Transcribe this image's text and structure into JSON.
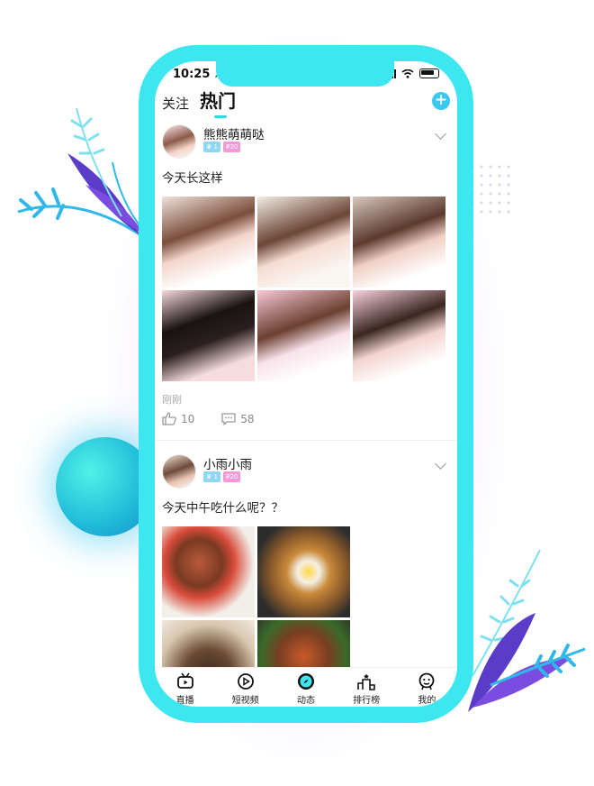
{
  "status_bar": {
    "time": "10:25",
    "time_arrow": "➚"
  },
  "tabs": {
    "follow": "关注",
    "hot": "热门"
  },
  "add_button": "+",
  "posts": [
    {
      "username": "熊熊萌萌哒",
      "level": "1",
      "points": "20",
      "caption": "今天长这样",
      "time_ago": "刚刚",
      "likes": "10",
      "comments": "58",
      "photo_count": 6
    },
    {
      "username": "小雨小雨",
      "level": "1",
      "points": "20",
      "caption": "今天中午吃什么呢？？",
      "photo_count": 4
    }
  ],
  "bottom_nav": [
    {
      "label": "直播",
      "icon": "tv-icon"
    },
    {
      "label": "短视频",
      "icon": "play-circle-icon"
    },
    {
      "label": "动态",
      "icon": "compass-icon"
    },
    {
      "label": "排行榜",
      "icon": "podium-icon"
    },
    {
      "label": "我的",
      "icon": "face-icon"
    }
  ],
  "colors": {
    "phone_frame": "#3ee6ef",
    "accent": "#3ac8f0",
    "badge_level": "#8fd8f5",
    "badge_points": "#f59ad8"
  }
}
